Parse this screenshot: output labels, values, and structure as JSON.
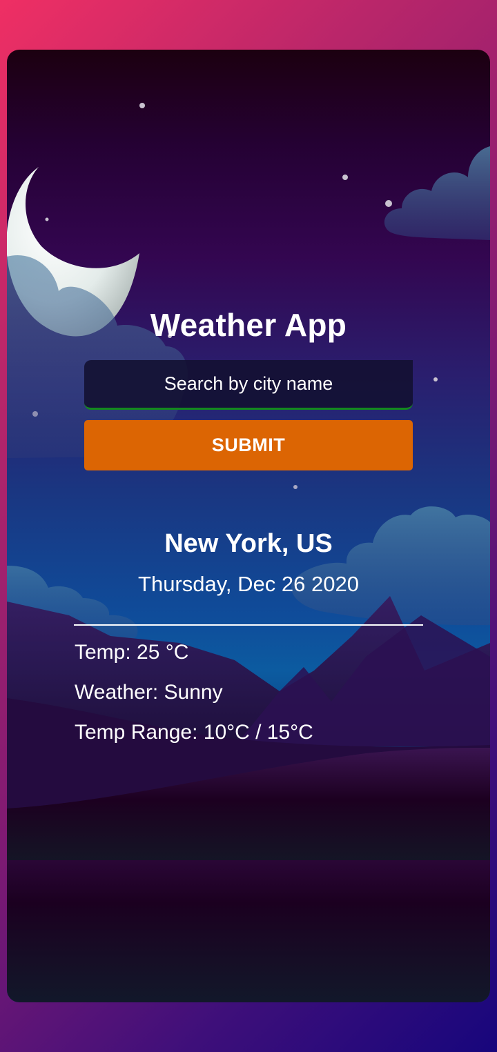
{
  "app": {
    "title": "Weather App"
  },
  "search": {
    "placeholder": "Search by city name",
    "value": ""
  },
  "submit": {
    "label": "SUBMIT"
  },
  "weather": {
    "location": "New York, US",
    "date": "Thursday, Dec 26 2020",
    "temp": "Temp: 25 °C",
    "condition": "Weather: Sunny",
    "range": "Temp Range: 10°C / 15°C"
  },
  "theme": {
    "accent": "#dc6503",
    "input_underline": "#138a1e",
    "input_background": "#121030",
    "text": "#ffffff"
  },
  "icons": {
    "background": "night-scene-illustration",
    "moon": "crescent-moon-icon",
    "clouds": "cloud-icon",
    "stars": "star-icon"
  }
}
